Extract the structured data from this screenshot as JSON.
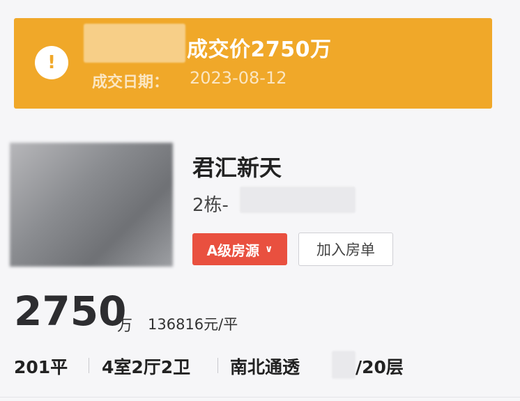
{
  "banner": {
    "deal_price": "成交价2750万",
    "deal_date_label": "成交日期：",
    "deal_date_value": "2023-08-12",
    "icon": "warning-icon",
    "color": "#f0a829"
  },
  "listing": {
    "title": "君汇新天",
    "building": "2栋-",
    "grade_badge": "A级房源",
    "grade_color": "#e9503f",
    "add_button": "加入房单"
  },
  "price": {
    "total": "2750",
    "unit": "万",
    "per_sqm": "136816元/平"
  },
  "specs": {
    "area": "201平",
    "layout": "4室2厅2卫",
    "orientation": "南北通透",
    "floors": "/20层"
  }
}
